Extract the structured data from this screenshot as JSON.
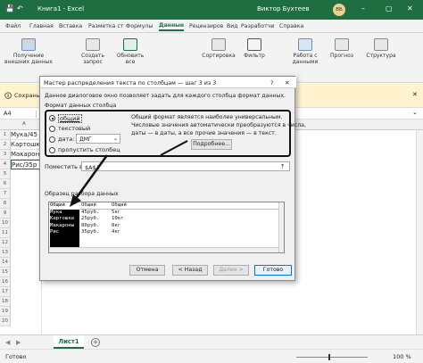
{
  "titlebar": {
    "file_title": "Книга1 - Excel",
    "user_name": "Виктор Бухтеев",
    "user_initials": "ВБ"
  },
  "ribbon_tabs": [
    "Файл",
    "Главная",
    "Вставка",
    "Разметка ст",
    "Формулы",
    "Данные",
    "Рецензиров",
    "Вид",
    "Разработчи",
    "Справка"
  ],
  "active_tab": "Данные",
  "ribbon": {
    "get_external": "Получение внешних данных",
    "create_query": "Создать запрос",
    "update_all": "Обновить все",
    "sort": "Сортировка",
    "filter": "Фильтр",
    "data_tools": "Работа с данными",
    "forecast": "Прогноз",
    "structure": "Структура"
  },
  "notice": {
    "save_text": "Сохрань",
    "close_symbol": "✕"
  },
  "namebox": "A4",
  "rows": [
    "1",
    "2",
    "3",
    "4",
    "5",
    "6",
    "7",
    "8",
    "9",
    "10",
    "11",
    "12",
    "13",
    "14",
    "15",
    "16",
    "17",
    "18",
    "19",
    "20"
  ],
  "cells": [
    "Мука/45",
    "Картошка",
    "Макарон",
    "Рис/35р"
  ],
  "dialog": {
    "title": "Мастер распределения текста по столбцам — шаг 3 из 3",
    "help": "?",
    "close": "✕",
    "intro": "Данное диалоговое окно позволяет задать для каждого столбца формат данных.",
    "format_group": "Формат данных столбца",
    "radio_general": "общий",
    "radio_text": "текстовый",
    "radio_date": "дата:",
    "date_value": "ДМГ",
    "radio_skip": "пропустить столбец",
    "desc1": "Общий формат является наиболее универсальным.",
    "desc2": "Числовые значения автоматически преобразуются в числа,",
    "desc3": "даты — в даты, а все прочие значения — в текст.",
    "more_button": "Подробнее...",
    "dest_label": "Поместить в:",
    "dest_value": "$A$1",
    "preview_label": "Образец разбора данных",
    "preview_headers": [
      "Общий",
      "Общий",
      "Общий"
    ],
    "preview_col1": [
      "Мука",
      "Картошка",
      "Макароны",
      "Рис"
    ],
    "preview_col2": [
      "45руб.",
      "25руб.",
      "80руб.",
      "35руб."
    ],
    "preview_col3": [
      "5кг",
      "10кг",
      "8кг",
      "4кг"
    ],
    "cancel": "Отмена",
    "back": "< Назад",
    "next": "Далее >",
    "finish": "Готово"
  },
  "sheet_tab": "Лист1",
  "status": {
    "ready": "Готово",
    "zoom": "100 %"
  },
  "colors": {
    "excel_green": "#1e6e42",
    "annotation": "#111111",
    "dialog_bg": "#f0f0f0",
    "accent_blue": "#0078d4"
  }
}
